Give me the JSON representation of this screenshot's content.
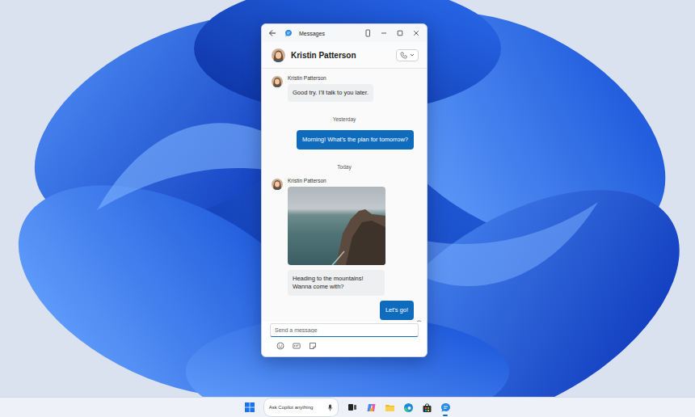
{
  "window": {
    "title": "Messages"
  },
  "contact": {
    "name": "Kristin Patterson"
  },
  "thread": [
    {
      "kind": "incoming",
      "sender": "Kristin Patterson",
      "parts": [
        {
          "kind": "text",
          "text": "Good try. I'll talk to you later."
        }
      ]
    },
    {
      "kind": "date",
      "text": "Yesterday"
    },
    {
      "kind": "outgoing",
      "parts": [
        {
          "kind": "text",
          "text": "Morning! What's the plan for tomorrow?"
        }
      ]
    },
    {
      "kind": "date",
      "text": "Today"
    },
    {
      "kind": "incoming",
      "sender": "Kristin Patterson",
      "parts": [
        {
          "kind": "photo"
        },
        {
          "kind": "text",
          "text": "Heading to the mountains! Wanna come with?"
        }
      ]
    },
    {
      "kind": "outgoing",
      "parts": [
        {
          "kind": "text",
          "text": "Let's go!"
        }
      ]
    }
  ],
  "composer": {
    "placeholder": "Send a message"
  },
  "taskbar": {
    "search": "Ask Copilot anything"
  }
}
